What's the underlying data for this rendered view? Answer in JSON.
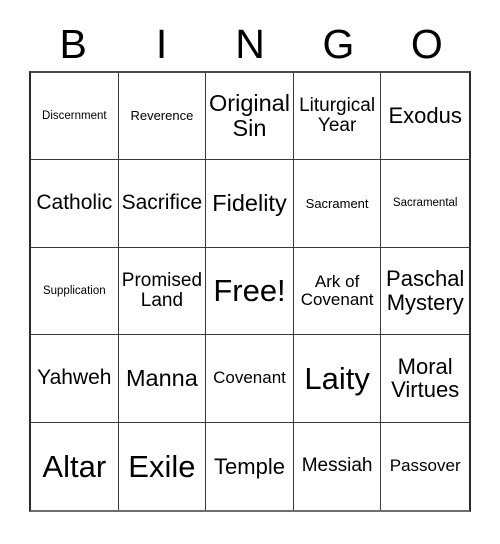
{
  "card": {
    "header": {
      "letters": [
        "B",
        "I",
        "N",
        "G",
        "O"
      ]
    },
    "grid": {
      "rows": 5,
      "columns": 5,
      "cells": [
        {
          "text": "Discernment",
          "size": "fs-11"
        },
        {
          "text": "Reverence",
          "size": "fs-13"
        },
        {
          "text": "Original\nSin",
          "size": "fs-23"
        },
        {
          "text": "Liturgical\nYear",
          "size": "fs-19"
        },
        {
          "text": "Exodus",
          "size": "fs-22"
        },
        {
          "text": "Catholic",
          "size": "fs-21"
        },
        {
          "text": "Sacrifice",
          "size": "fs-21"
        },
        {
          "text": "Fidelity",
          "size": "fs-23"
        },
        {
          "text": "Sacrament",
          "size": "fs-13"
        },
        {
          "text": "Sacramental",
          "size": "fs-11"
        },
        {
          "text": "Supplication",
          "size": "fs-11"
        },
        {
          "text": "Promised\nLand",
          "size": "fs-19"
        },
        {
          "text": "Free!",
          "size": "fs-30"
        },
        {
          "text": "Ark of\nCovenant",
          "size": "fs-17"
        },
        {
          "text": "Paschal\nMystery",
          "size": "fs-22"
        },
        {
          "text": "Yahweh",
          "size": "fs-21"
        },
        {
          "text": "Manna",
          "size": "fs-23"
        },
        {
          "text": "Covenant",
          "size": "fs-17"
        },
        {
          "text": "Laity",
          "size": "fs-30"
        },
        {
          "text": "Moral\nVirtues",
          "size": "fs-22"
        },
        {
          "text": "Altar",
          "size": "fs-30"
        },
        {
          "text": "Exile",
          "size": "fs-30"
        },
        {
          "text": "Temple",
          "size": "fs-22"
        },
        {
          "text": "Messiah",
          "size": "fs-19"
        },
        {
          "text": "Passover",
          "size": "fs-17"
        }
      ]
    },
    "colors": {
      "background": "#ffffff",
      "text": "#000000",
      "grid_line": "#3a3a3a",
      "grid_border": "#2b2b2b"
    }
  }
}
